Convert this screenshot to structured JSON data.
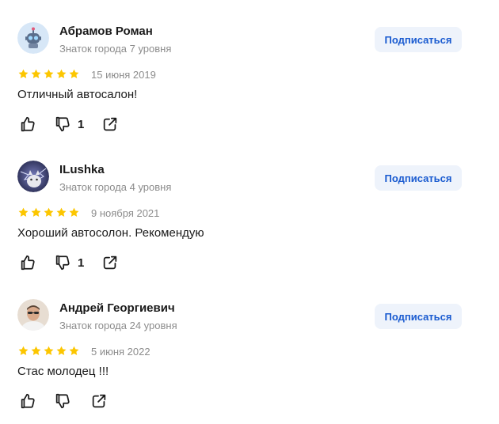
{
  "subscribe_label": "Подписаться",
  "reviews": [
    {
      "author": "Абрамов Роман",
      "level": "Знаток города 7 уровня",
      "avatar_icon": "robot-avatar-icon",
      "rating": 5,
      "date": "15 июня 2019",
      "text": "Отличный автосалон!",
      "dislikes": "1"
    },
    {
      "author": "ILushka",
      "level": "Знаток города 4 уровня",
      "avatar_icon": "photo-avatar-icon",
      "rating": 5,
      "date": "9 ноября 2021",
      "text": "Хороший автосолон. Рекомендую",
      "dislikes": "1"
    },
    {
      "author": "Андрей Георгиевич",
      "level": "Знаток города 24 уровня",
      "avatar_icon": "photo-avatar-icon",
      "rating": 5,
      "date": "5 июня 2022",
      "text": "Стас молодец !!!",
      "dislikes": ""
    }
  ],
  "colors": {
    "star": "#fcc600",
    "accent": "#1a5bd0",
    "button_bg": "#eef3fb",
    "muted": "#8c8c8c"
  }
}
